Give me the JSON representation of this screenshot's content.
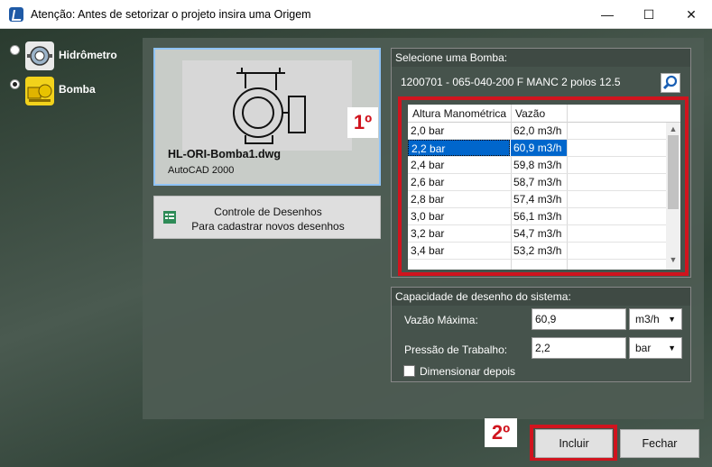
{
  "window": {
    "title": "Atenção: Antes de setorizar o projeto insira uma Origem",
    "minimize": "—",
    "maximize": "☐",
    "close": "✕"
  },
  "options": [
    {
      "label": "Hidrômetro",
      "checked": false,
      "icon": "water-meter-icon"
    },
    {
      "label": "Bomba",
      "checked": true,
      "icon": "pump-icon"
    }
  ],
  "drawing": {
    "name": "HL-ORI-Bomba1.dwg",
    "format": "AutoCAD 2000"
  },
  "controle": {
    "line1": "Controle de Desenhos",
    "line2": "Para cadastrar novos desenhos"
  },
  "markers": {
    "first": "1º",
    "second": "2º"
  },
  "bomba": {
    "header": "Selecione uma Bomba:",
    "selected_code": "1200701 - 065-040-200 F MANC 2 polos 12.5",
    "table": {
      "headers": [
        "Altura Manométrica",
        "Vazão"
      ],
      "rows": [
        {
          "altura": "2,0 bar",
          "vazao": "62,0 m3/h"
        },
        {
          "altura": "2,2 bar",
          "vazao": "60,9 m3/h"
        },
        {
          "altura": "2,4 bar",
          "vazao": "59,8 m3/h"
        },
        {
          "altura": "2,6 bar",
          "vazao": "58,7 m3/h"
        },
        {
          "altura": "2,8 bar",
          "vazao": "57,4 m3/h"
        },
        {
          "altura": "3,0 bar",
          "vazao": "56,1 m3/h"
        },
        {
          "altura": "3,2 bar",
          "vazao": "54,7 m3/h"
        },
        {
          "altura": "3,4 bar",
          "vazao": "53,2 m3/h"
        }
      ],
      "selected_index": 1
    }
  },
  "capacidade": {
    "header": "Capacidade de desenho do sistema:",
    "vazao_label": "Vazão Máxima:",
    "vazao_value": "60,9",
    "vazao_unit": "m3/h",
    "pressao_label": "Pressão de Trabalho:",
    "pressao_value": "2,2",
    "pressao_unit": "bar",
    "dimensionar_label": "Dimensionar depois"
  },
  "buttons": {
    "incluir": "Incluir",
    "fechar": "Fechar"
  },
  "colors": {
    "highlight_red": "#d0141e",
    "selection_blue": "#0066cc"
  }
}
